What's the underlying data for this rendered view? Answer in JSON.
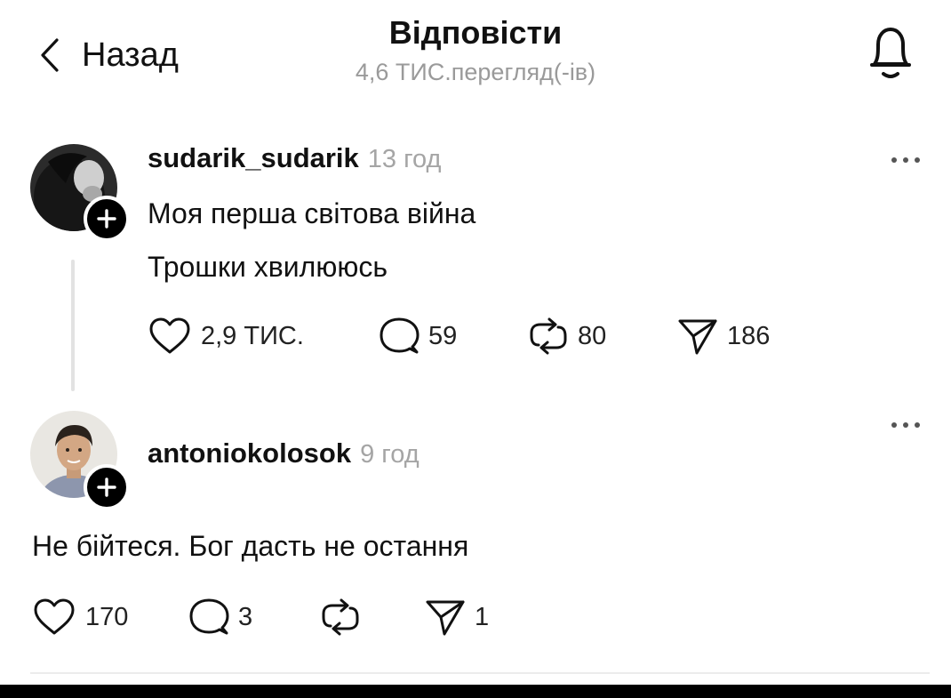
{
  "header": {
    "back_label": "Назад",
    "title": "Відповісти",
    "views": "4,6 ТИС.перегляд(-ів)"
  },
  "posts": [
    {
      "username": "sudarik_sudarik",
      "time": "13 год",
      "lines": [
        "Моя перша світова війна",
        "Трошки хвилююсь"
      ],
      "likes": "2,9 ТИС.",
      "replies": "59",
      "reposts": "80",
      "shares": "186"
    },
    {
      "username": "antoniokolosok",
      "time": "9 год",
      "lines": [
        "Не бійтеся. Бог дасть не остання"
      ],
      "likes": "170",
      "replies": "3",
      "reposts": "",
      "shares": "1"
    }
  ],
  "colors": {
    "text": "#111111",
    "muted": "#a5a5a5",
    "line": "#e2e2e2"
  },
  "icons": [
    "chevron-left-icon",
    "bell-icon",
    "plus-icon",
    "more-icon",
    "heart-icon",
    "comment-icon",
    "repost-icon",
    "send-icon"
  ]
}
